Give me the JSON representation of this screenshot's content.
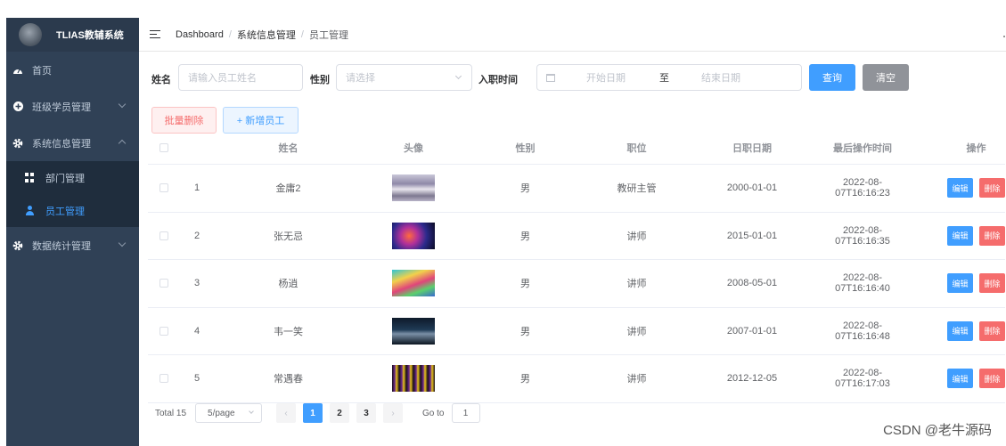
{
  "sidebar": {
    "logo_text": "TLIAS教辅系统",
    "menu": [
      {
        "label": "首页"
      },
      {
        "label": "班级学员管理"
      },
      {
        "label": "系统信息管理"
      },
      {
        "label": "数据统计管理"
      }
    ],
    "submenu": [
      {
        "label": "部门管理"
      },
      {
        "label": "员工管理"
      }
    ]
  },
  "breadcrumb": {
    "items": [
      "Dashboard",
      "系统信息管理",
      "员工管理"
    ],
    "separator": "/"
  },
  "search": {
    "name_label": "姓名",
    "name_placeholder": "请输入员工姓名",
    "gender_label": "性别",
    "gender_placeholder": "请选择",
    "entry_label": "入职时间",
    "start_placeholder": "开始日期",
    "range_separator": "至",
    "end_placeholder": "结束日期",
    "query_button": "查询",
    "clear_button": "清空"
  },
  "actions": {
    "batch_delete": "批量删除",
    "add_employee": "+ 新增员工"
  },
  "table": {
    "columns": [
      "姓名",
      "头像",
      "性别",
      "职位",
      "日职日期",
      "最后操作时间",
      "操作"
    ],
    "edit_label": "编辑",
    "delete_label": "删除",
    "rows": [
      {
        "index": "1",
        "name": "金庸2",
        "gender": "男",
        "job": "教研主管",
        "entry_date": "2000-01-01",
        "update_time": "2022-08-07T16:16:23"
      },
      {
        "index": "2",
        "name": "张无忌",
        "gender": "男",
        "job": "讲师",
        "entry_date": "2015-01-01",
        "update_time": "2022-08-07T16:16:35"
      },
      {
        "index": "3",
        "name": "杨逍",
        "gender": "男",
        "job": "讲师",
        "entry_date": "2008-05-01",
        "update_time": "2022-08-07T16:16:40"
      },
      {
        "index": "4",
        "name": "韦一笑",
        "gender": "男",
        "job": "讲师",
        "entry_date": "2007-01-01",
        "update_time": "2022-08-07T16:16:48"
      },
      {
        "index": "5",
        "name": "常遇春",
        "gender": "男",
        "job": "讲师",
        "entry_date": "2012-12-05",
        "update_time": "2022-08-07T16:17:03"
      }
    ]
  },
  "pagination": {
    "total_text": "Total 15",
    "page_size": "5/page",
    "pages": [
      "1",
      "2",
      "3"
    ],
    "current_page": "1",
    "goto_label": "Go to",
    "goto_value": "1"
  },
  "watermark": "CSDN @老牛源码",
  "colors": {
    "sidebar_bg": "#304156",
    "primary": "#409eff",
    "danger": "#f56c6c",
    "info": "#909399"
  }
}
